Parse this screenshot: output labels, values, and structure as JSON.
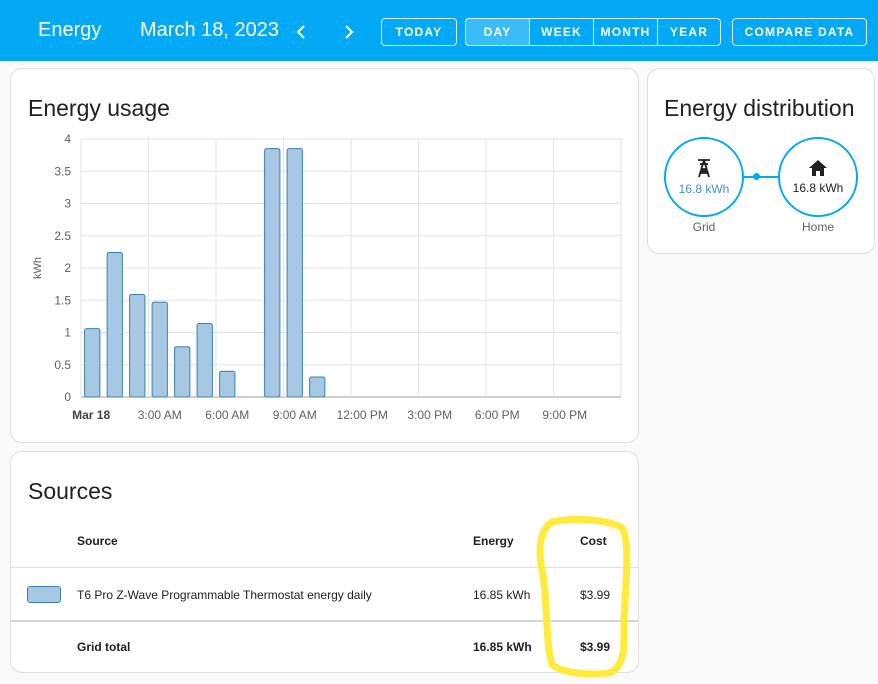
{
  "header": {
    "title": "Energy",
    "date": "March 18, 2023",
    "today_label": "TODAY",
    "periods": [
      {
        "label": "DAY",
        "active": true
      },
      {
        "label": "WEEK",
        "active": false
      },
      {
        "label": "MONTH",
        "active": false
      },
      {
        "label": "YEAR",
        "active": false
      }
    ],
    "compare_label": "COMPARE DATA",
    "prev_icon": "chevron-left-icon",
    "next_icon": "chevron-right-icon"
  },
  "usage_card": {
    "title": "Energy usage"
  },
  "distribution_card": {
    "title": "Energy distribution",
    "grid": {
      "value": "16.8 kWh",
      "label": "Grid",
      "icon": "transmission-tower-icon"
    },
    "home": {
      "value": "16.8 kWh",
      "label": "Home",
      "icon": "home-icon"
    }
  },
  "sources_card": {
    "title": "Sources",
    "columns": {
      "source": "Source",
      "energy": "Energy",
      "cost": "Cost"
    },
    "rows": [
      {
        "source": "T6 Pro Z-Wave Programmable Thermostat energy daily",
        "energy": "16.85 kWh",
        "cost": "$3.99"
      }
    ],
    "total": {
      "source": "Grid total",
      "energy": "16.85 kWh",
      "cost": "$3.99"
    }
  },
  "colors": {
    "accent": "#03a9f4",
    "bar_fill": "#a6c8e3",
    "bar_stroke": "#3f7fb0",
    "highlight": "#ffeb3b"
  },
  "chart_data": {
    "type": "bar",
    "ylabel": "kWh",
    "ylim": [
      0,
      4
    ],
    "yticks": [
      "0",
      "0.5",
      "1",
      "1.5",
      "2",
      "2.5",
      "3",
      "3.5",
      "4"
    ],
    "xtick_labels": [
      "Mar 18",
      "3:00 AM",
      "6:00 AM",
      "9:00 AM",
      "12:00 PM",
      "3:00 PM",
      "6:00 PM",
      "9:00 PM"
    ],
    "x_hours": [
      0,
      1,
      2,
      3,
      4,
      5,
      6,
      7,
      8,
      9,
      10,
      11,
      12,
      13,
      14,
      15,
      16,
      17,
      18,
      19,
      20,
      21,
      22,
      23
    ],
    "values": [
      1.06,
      2.24,
      1.59,
      1.47,
      0.78,
      1.14,
      0.4,
      0,
      3.85,
      3.85,
      0.31,
      0,
      0,
      0,
      0,
      0,
      0,
      0,
      0,
      0,
      0,
      0,
      0,
      0
    ],
    "grid": true
  }
}
